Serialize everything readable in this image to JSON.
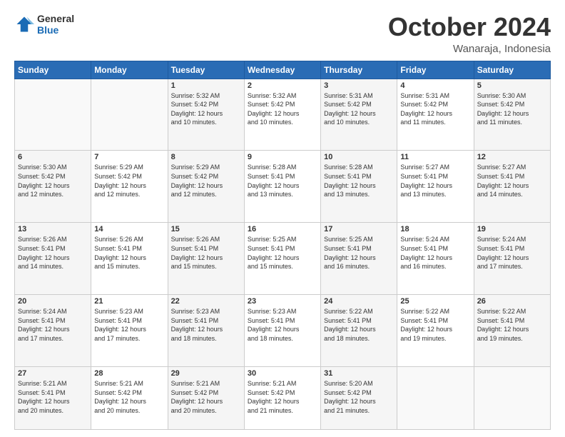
{
  "header": {
    "logo_line1": "General",
    "logo_line2": "Blue",
    "month": "October 2024",
    "location": "Wanaraja, Indonesia"
  },
  "weekdays": [
    "Sunday",
    "Monday",
    "Tuesday",
    "Wednesday",
    "Thursday",
    "Friday",
    "Saturday"
  ],
  "weeks": [
    [
      {
        "day": "",
        "info": ""
      },
      {
        "day": "",
        "info": ""
      },
      {
        "day": "1",
        "info": "Sunrise: 5:32 AM\nSunset: 5:42 PM\nDaylight: 12 hours\nand 10 minutes."
      },
      {
        "day": "2",
        "info": "Sunrise: 5:32 AM\nSunset: 5:42 PM\nDaylight: 12 hours\nand 10 minutes."
      },
      {
        "day": "3",
        "info": "Sunrise: 5:31 AM\nSunset: 5:42 PM\nDaylight: 12 hours\nand 10 minutes."
      },
      {
        "day": "4",
        "info": "Sunrise: 5:31 AM\nSunset: 5:42 PM\nDaylight: 12 hours\nand 11 minutes."
      },
      {
        "day": "5",
        "info": "Sunrise: 5:30 AM\nSunset: 5:42 PM\nDaylight: 12 hours\nand 11 minutes."
      }
    ],
    [
      {
        "day": "6",
        "info": "Sunrise: 5:30 AM\nSunset: 5:42 PM\nDaylight: 12 hours\nand 12 minutes."
      },
      {
        "day": "7",
        "info": "Sunrise: 5:29 AM\nSunset: 5:42 PM\nDaylight: 12 hours\nand 12 minutes."
      },
      {
        "day": "8",
        "info": "Sunrise: 5:29 AM\nSunset: 5:42 PM\nDaylight: 12 hours\nand 12 minutes."
      },
      {
        "day": "9",
        "info": "Sunrise: 5:28 AM\nSunset: 5:41 PM\nDaylight: 12 hours\nand 13 minutes."
      },
      {
        "day": "10",
        "info": "Sunrise: 5:28 AM\nSunset: 5:41 PM\nDaylight: 12 hours\nand 13 minutes."
      },
      {
        "day": "11",
        "info": "Sunrise: 5:27 AM\nSunset: 5:41 PM\nDaylight: 12 hours\nand 13 minutes."
      },
      {
        "day": "12",
        "info": "Sunrise: 5:27 AM\nSunset: 5:41 PM\nDaylight: 12 hours\nand 14 minutes."
      }
    ],
    [
      {
        "day": "13",
        "info": "Sunrise: 5:26 AM\nSunset: 5:41 PM\nDaylight: 12 hours\nand 14 minutes."
      },
      {
        "day": "14",
        "info": "Sunrise: 5:26 AM\nSunset: 5:41 PM\nDaylight: 12 hours\nand 15 minutes."
      },
      {
        "day": "15",
        "info": "Sunrise: 5:26 AM\nSunset: 5:41 PM\nDaylight: 12 hours\nand 15 minutes."
      },
      {
        "day": "16",
        "info": "Sunrise: 5:25 AM\nSunset: 5:41 PM\nDaylight: 12 hours\nand 15 minutes."
      },
      {
        "day": "17",
        "info": "Sunrise: 5:25 AM\nSunset: 5:41 PM\nDaylight: 12 hours\nand 16 minutes."
      },
      {
        "day": "18",
        "info": "Sunrise: 5:24 AM\nSunset: 5:41 PM\nDaylight: 12 hours\nand 16 minutes."
      },
      {
        "day": "19",
        "info": "Sunrise: 5:24 AM\nSunset: 5:41 PM\nDaylight: 12 hours\nand 17 minutes."
      }
    ],
    [
      {
        "day": "20",
        "info": "Sunrise: 5:24 AM\nSunset: 5:41 PM\nDaylight: 12 hours\nand 17 minutes."
      },
      {
        "day": "21",
        "info": "Sunrise: 5:23 AM\nSunset: 5:41 PM\nDaylight: 12 hours\nand 17 minutes."
      },
      {
        "day": "22",
        "info": "Sunrise: 5:23 AM\nSunset: 5:41 PM\nDaylight: 12 hours\nand 18 minutes."
      },
      {
        "day": "23",
        "info": "Sunrise: 5:23 AM\nSunset: 5:41 PM\nDaylight: 12 hours\nand 18 minutes."
      },
      {
        "day": "24",
        "info": "Sunrise: 5:22 AM\nSunset: 5:41 PM\nDaylight: 12 hours\nand 18 minutes."
      },
      {
        "day": "25",
        "info": "Sunrise: 5:22 AM\nSunset: 5:41 PM\nDaylight: 12 hours\nand 19 minutes."
      },
      {
        "day": "26",
        "info": "Sunrise: 5:22 AM\nSunset: 5:41 PM\nDaylight: 12 hours\nand 19 minutes."
      }
    ],
    [
      {
        "day": "27",
        "info": "Sunrise: 5:21 AM\nSunset: 5:41 PM\nDaylight: 12 hours\nand 20 minutes."
      },
      {
        "day": "28",
        "info": "Sunrise: 5:21 AM\nSunset: 5:42 PM\nDaylight: 12 hours\nand 20 minutes."
      },
      {
        "day": "29",
        "info": "Sunrise: 5:21 AM\nSunset: 5:42 PM\nDaylight: 12 hours\nand 20 minutes."
      },
      {
        "day": "30",
        "info": "Sunrise: 5:21 AM\nSunset: 5:42 PM\nDaylight: 12 hours\nand 21 minutes."
      },
      {
        "day": "31",
        "info": "Sunrise: 5:20 AM\nSunset: 5:42 PM\nDaylight: 12 hours\nand 21 minutes."
      },
      {
        "day": "",
        "info": ""
      },
      {
        "day": "",
        "info": ""
      }
    ]
  ]
}
